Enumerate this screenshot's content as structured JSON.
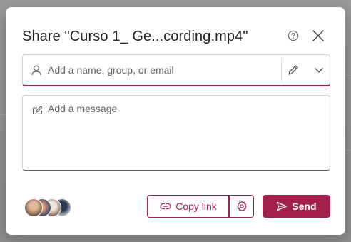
{
  "dialog": {
    "title": "Share \"Curso 1_ Ge...cording.mp4\"",
    "help_icon": "question-circle-icon",
    "close_icon": "close-icon"
  },
  "people_field": {
    "placeholder": "Add a name, group, or email",
    "value": "",
    "leading_icon": "person-icon",
    "permission_icon": "pencil-icon",
    "permission_dropdown_icon": "chevron-down-icon"
  },
  "message_field": {
    "placeholder": "Add a message",
    "value": "",
    "icon": "compose-icon"
  },
  "shared_with": {
    "avatar_count": 4
  },
  "actions": {
    "copy_link_label": "Copy link",
    "copy_link_icon": "link-icon",
    "settings_icon": "gear-icon",
    "send_label": "Send",
    "send_icon": "send-icon"
  },
  "colors": {
    "accent": "#a4204c",
    "text": "#242424",
    "placeholder": "#616161",
    "overlay": "#8d8d8d"
  }
}
